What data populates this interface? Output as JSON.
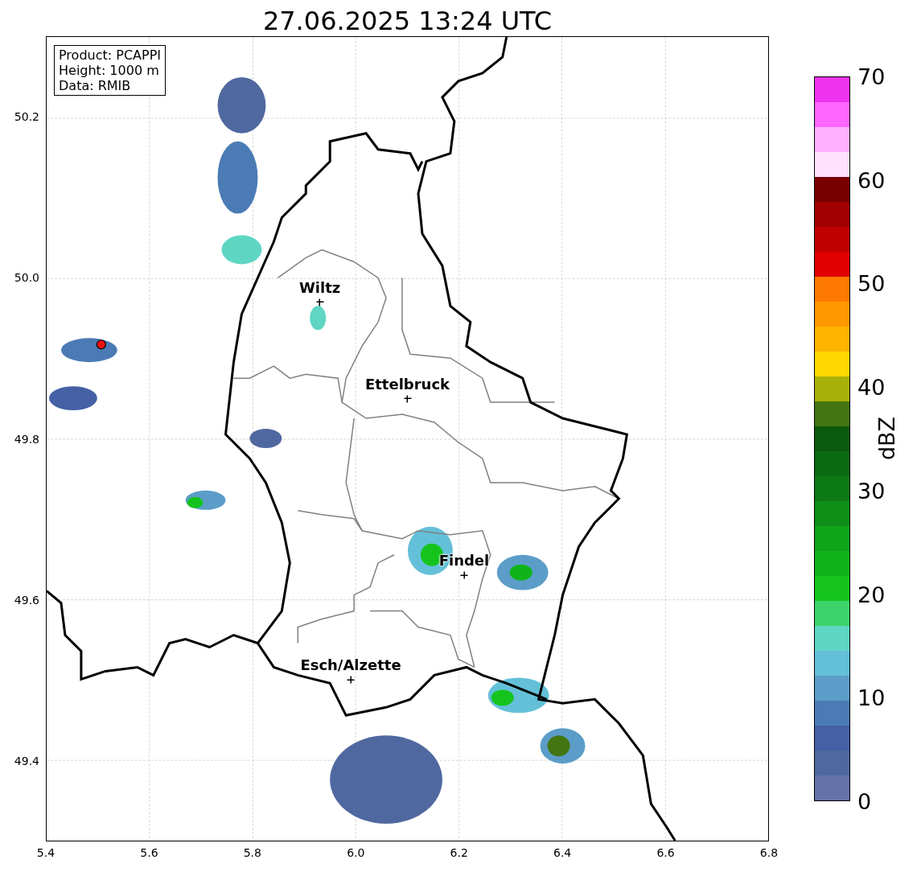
{
  "title": "27.06.2025 13:24 UTC",
  "map": {
    "info_box": [
      "Product: PCAPPI",
      "Height: 1000 m",
      "Data: RMIB"
    ],
    "xticks": [
      "5.4",
      "5.6",
      "5.8",
      "6.0",
      "6.2",
      "6.4",
      "6.6",
      "6.8"
    ],
    "yticks": [
      "50.2",
      "50.0",
      "49.8",
      "49.6",
      "49.4"
    ],
    "cities": [
      {
        "name": "Wiltz"
      },
      {
        "name": "Ettelbruck"
      },
      {
        "name": "Findel"
      },
      {
        "name": "Esch/Alzette"
      }
    ]
  },
  "colorbar": {
    "label": "dBZ",
    "ticks": [
      "70",
      "60",
      "50",
      "40",
      "30",
      "20",
      "10",
      "0"
    ],
    "bins": [
      {
        "color": "#6372a8"
      },
      {
        "color": "#5068a0"
      },
      {
        "color": "#4560a5"
      },
      {
        "color": "#4b7bb4"
      },
      {
        "color": "#5b9dc8"
      },
      {
        "color": "#63c0d8"
      },
      {
        "color": "#5fd6c4"
      },
      {
        "color": "#3cd46a"
      },
      {
        "color": "#14c41c"
      },
      {
        "color": "#10b41a"
      },
      {
        "color": "#0fa519"
      },
      {
        "color": "#0e8f16"
      },
      {
        "color": "#0c7a14"
      },
      {
        "color": "#0a6a12"
      },
      {
        "color": "#0b5a0e"
      },
      {
        "color": "#437510"
      },
      {
        "color": "#aab00a"
      },
      {
        "color": "#ffd800"
      },
      {
        "color": "#ffb400"
      },
      {
        "color": "#ff9800"
      },
      {
        "color": "#ff7a00"
      },
      {
        "color": "#e00000"
      },
      {
        "color": "#c00000"
      },
      {
        "color": "#a00000"
      },
      {
        "color": "#780000"
      },
      {
        "color": "#ffe0ff"
      },
      {
        "color": "#ffb0ff"
      },
      {
        "color": "#ff66ff"
      },
      {
        "color": "#ee33ee"
      }
    ]
  }
}
